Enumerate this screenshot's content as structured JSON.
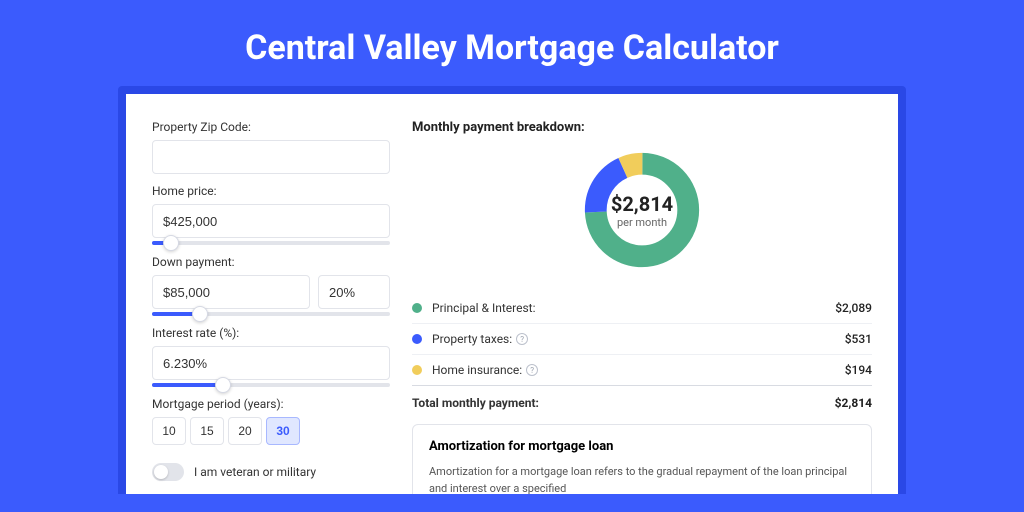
{
  "title": "Central Valley Mortgage Calculator",
  "form": {
    "zip_label": "Property Zip Code:",
    "zip_value": "",
    "home_price_label": "Home price:",
    "home_price_value": "$425,000",
    "down_payment_label": "Down payment:",
    "down_payment_amount": "$85,000",
    "down_payment_percent": "20%",
    "interest_label": "Interest rate (%):",
    "interest_value": "6.230%",
    "period_label": "Mortgage period (years):",
    "period_options": [
      {
        "label": "10",
        "active": false
      },
      {
        "label": "15",
        "active": false
      },
      {
        "label": "20",
        "active": false
      },
      {
        "label": "30",
        "active": true
      }
    ],
    "veteran_label": "I am veteran or military",
    "sliders": {
      "home_price_pct": 8,
      "down_payment_pct": 20,
      "interest_pct": 30
    }
  },
  "breakdown": {
    "title": "Monthly payment breakdown:",
    "donut_amount": "$2,814",
    "donut_sub": "per month",
    "items": [
      {
        "color": "#50b08a",
        "label": "Principal & Interest:",
        "value": "$2,089",
        "help": false,
        "fraction": 0.742
      },
      {
        "color": "#3b5bfd",
        "label": "Property taxes:",
        "value": "$531",
        "help": true,
        "fraction": 0.189
      },
      {
        "color": "#f1cd5b",
        "label": "Home insurance:",
        "value": "$194",
        "help": true,
        "fraction": 0.069
      }
    ],
    "total_label": "Total monthly payment:",
    "total_value": "$2,814"
  },
  "amortization": {
    "title": "Amortization for mortgage loan",
    "text": "Amortization for a mortgage loan refers to the gradual repayment of the loan principal and interest over a specified"
  },
  "chart_data": {
    "type": "pie",
    "title": "Monthly payment breakdown",
    "series": [
      {
        "name": "Principal & Interest",
        "value": 2089,
        "color": "#50b08a"
      },
      {
        "name": "Property taxes",
        "value": 531,
        "color": "#3b5bfd"
      },
      {
        "name": "Home insurance",
        "value": 194,
        "color": "#f1cd5b"
      }
    ],
    "total": 2814,
    "center_label": "$2,814 per month"
  }
}
